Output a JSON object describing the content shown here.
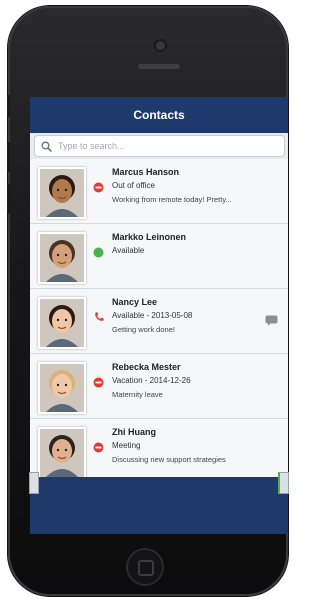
{
  "app": {
    "title": "Contacts"
  },
  "search": {
    "placeholder": "Type to search..."
  },
  "contacts": [
    {
      "name": "Marcus Hanson",
      "status": "Out of office",
      "note": "Working from remote today! Pretty...",
      "presence": "away",
      "skin": "#b07a4e",
      "hair": "#2a1a10"
    },
    {
      "name": "Markko Leinonen",
      "status": "Available",
      "note": "",
      "presence": "available",
      "skin": "#d4a07a",
      "hair": "#4a3322"
    },
    {
      "name": "Nancy Lee",
      "status": "Available - 2013-05-08",
      "note": "Getting work done!",
      "presence": "on-call",
      "skin": "#f0c7a2",
      "hair": "#2b1a12"
    },
    {
      "name": "Rebecka Mester",
      "status": "Vacation - 2014-12-26",
      "note": "Maternity leave",
      "presence": "away",
      "skin": "#efc9a8",
      "hair": "#d8b27a"
    },
    {
      "name": "Zhi Huang",
      "status": "Meeting",
      "note": "Discussing new support strategies",
      "presence": "busy",
      "skin": "#e0b090",
      "hair": "#2b2320"
    }
  ],
  "colors": {
    "header": "#1e3a6c",
    "available": "#4caf50",
    "busy": "#e53935",
    "phone": "#e53935"
  }
}
